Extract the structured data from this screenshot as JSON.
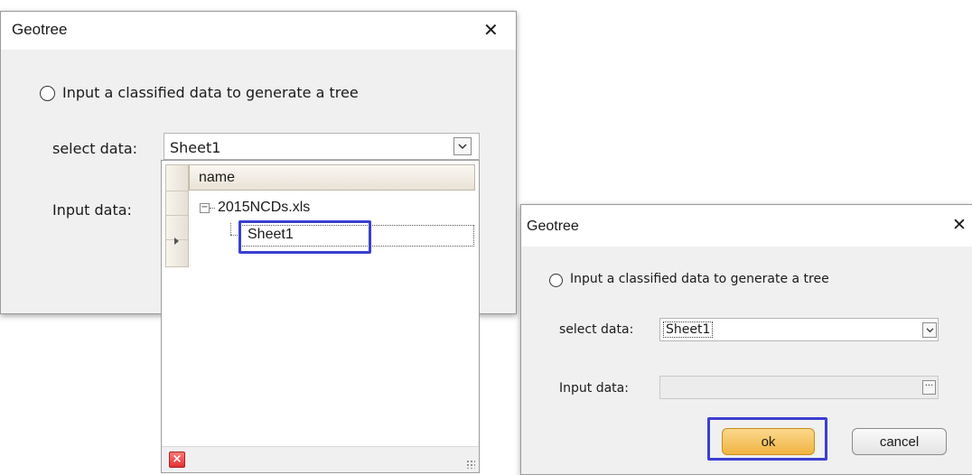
{
  "dialog1": {
    "title": "Geotree",
    "close_glyph": "✕",
    "radio_label": "Input a classified data to generate a tree",
    "select_label": "select data:",
    "select_value": "Sheet1",
    "input_label": "Input data:"
  },
  "dropdown": {
    "column_header": "name",
    "items": [
      {
        "label": "2015NCDs.xls",
        "expander": "−"
      },
      {
        "label": "Sheet1"
      }
    ],
    "delete_glyph": "×"
  },
  "dialog2": {
    "title": "Geotree",
    "close_glyph": "✕",
    "radio_label": "Input a classified data to generate a tree",
    "select_label": "select data:",
    "select_value": "Sheet1",
    "input_label": "Input data:",
    "input_value": "",
    "ellipsis": "···",
    "ok_label": "ok",
    "cancel_label": "cancel"
  },
  "colors": {
    "highlight": "#3b3fd1",
    "ok_fill": "#f6c46a"
  }
}
